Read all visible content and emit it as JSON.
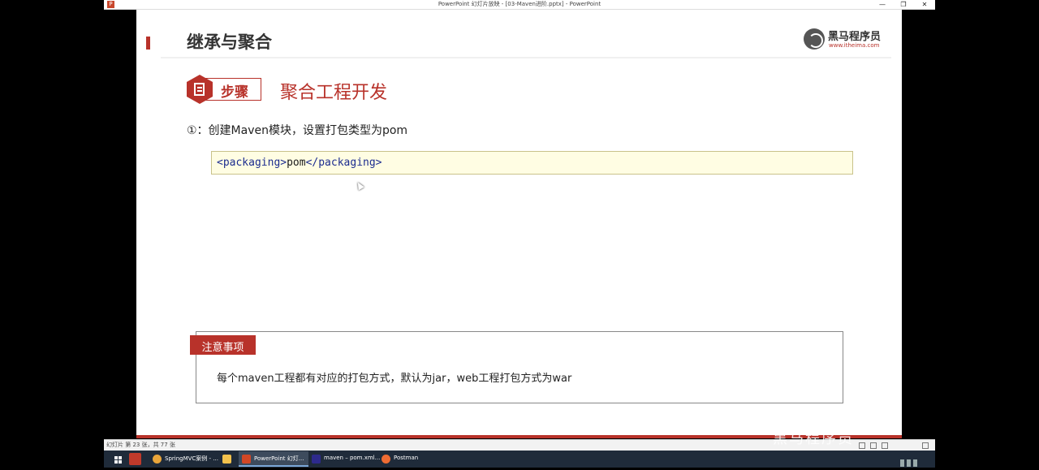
{
  "window": {
    "title": "PowerPoint 幻灯片放映 - [03-Maven进阶.pptx] - PowerPoint",
    "controls": {
      "minimize": "—",
      "restore": "❐",
      "close": "✕"
    }
  },
  "slide": {
    "title": "继承与聚合",
    "logo": {
      "name": "黑马程序员",
      "url": "www.itheima.com"
    },
    "step_label": "步骤",
    "step_title": "聚合工程开发",
    "item": "①：创建Maven模块，设置打包类型为pom",
    "code": {
      "open_tag": "<packaging>",
      "value": "pom",
      "close_tag": "</packaging>"
    },
    "note": {
      "label": "注意事项",
      "text": "每个maven工程都有对应的打包方式，默认为jar，web工程打包方式为war"
    }
  },
  "statusbar": {
    "text": "幻灯片 第 23 张，共 77 张"
  },
  "watermark": "黑马程序员",
  "taskbar": {
    "apps": [
      {
        "label": "SpringMVC案例 - ...",
        "icon": "chrome-icon",
        "color": "#e9a53a"
      },
      {
        "label": "",
        "icon": "explorer-icon",
        "color": "#f3c24d"
      },
      {
        "label": "PowerPoint 幻灯...",
        "icon": "powerpoint-icon",
        "color": "#d24726"
      },
      {
        "label": "maven – pom.xml...",
        "icon": "intellij-icon",
        "color": "#2d2a8c"
      },
      {
        "label": "Postman",
        "icon": "postman-icon",
        "color": "#ef6c33"
      }
    ]
  }
}
